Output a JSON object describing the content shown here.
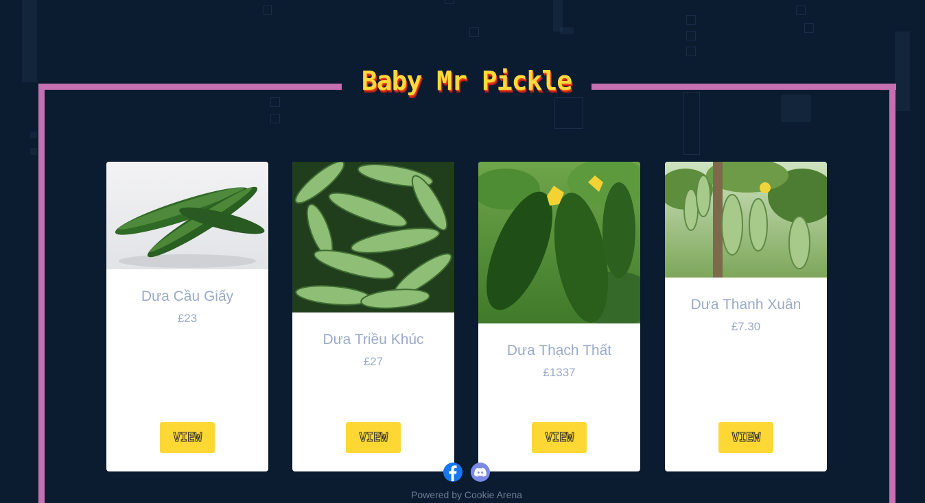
{
  "header": {
    "title": "Baby Mr Pickle"
  },
  "products": [
    {
      "name": "Dưa Cầu Giấy",
      "price": "£23",
      "button": "VIEW",
      "image": "two-cucumbers-on-white"
    },
    {
      "name": "Dưa Triều Khúc",
      "price": "£27",
      "button": "VIEW",
      "image": "pile-of-cucumbers"
    },
    {
      "name": "Dưa Thạch Thất",
      "price": "£1337",
      "button": "VIEW",
      "image": "cucumbers-on-vine-with-flowers"
    },
    {
      "name": "Dưa Thanh Xuân",
      "price": "£7.30",
      "button": "VIEW",
      "image": "hanging-cucumbers-in-greenhouse"
    }
  ],
  "footer": {
    "social": [
      {
        "icon": "facebook-icon",
        "color": "#1877f2"
      },
      {
        "icon": "discord-icon",
        "color": "#7c8ae6"
      }
    ],
    "powered_by": "Powered by Cookie Arena"
  },
  "colors": {
    "background": "#0b1c31",
    "frame": "#c770b1",
    "title": "#ffd93a",
    "button": "#fdd835",
    "card_text": "#9aaac8"
  }
}
